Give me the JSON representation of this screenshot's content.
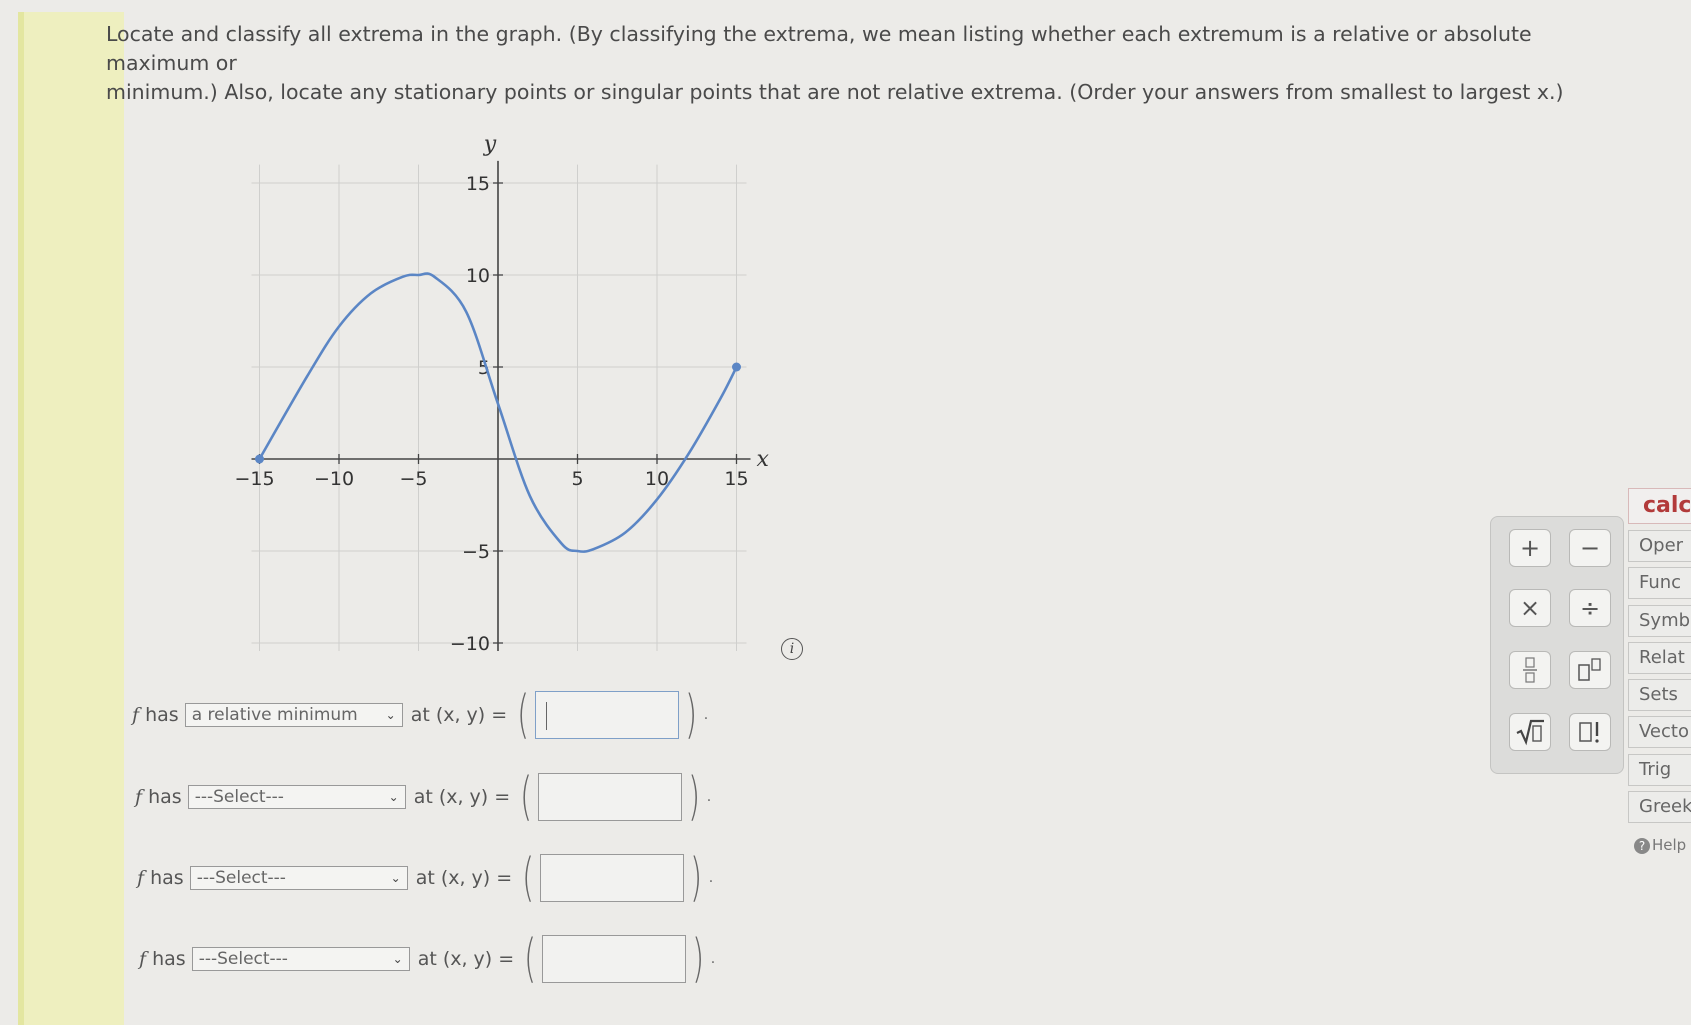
{
  "prompt": {
    "line1": "Locate and classify all extrema in the graph. (By classifying the extrema, we mean listing whether each extremum is a relative or absolute maximum or",
    "line2": "minimum.) Also, locate any stationary points or singular points that are not relative extrema. (Order your answers from smallest to largest x.)"
  },
  "graph": {
    "x_axis_label": "x",
    "y_axis_label": "y",
    "x_ticks": [
      "−15",
      "−10",
      "−5",
      "5",
      "10",
      "15"
    ],
    "y_ticks": [
      "15",
      "10",
      "5",
      "−5",
      "−10"
    ],
    "curve_color": "#5b86c5"
  },
  "chart_data": {
    "type": "line",
    "xlim": [
      -15,
      15
    ],
    "ylim": [
      -10,
      15
    ],
    "grid": true,
    "x": [
      -15,
      -12,
      -10,
      -8,
      -6,
      -5,
      -4,
      -2,
      0,
      2,
      4,
      5,
      6,
      8,
      10,
      12,
      14,
      15
    ],
    "y": [
      0,
      4.5,
      7.2,
      9,
      9.9,
      10,
      9.9,
      8,
      3,
      -2,
      -4.6,
      -5,
      -4.9,
      -4,
      -2.2,
      0.3,
      3.3,
      5
    ],
    "endpoints": [
      [
        -15,
        0
      ],
      [
        15,
        5
      ]
    ]
  },
  "rows": [
    {
      "fhas": "has",
      "select": "a relative minimum",
      "at": "at (x, y) =",
      "value": ""
    },
    {
      "fhas": "has",
      "select": "---Select---",
      "at": "at (x, y) =",
      "value": ""
    },
    {
      "fhas": "has",
      "select": "---Select---",
      "at": "at (x, y) =",
      "value": ""
    },
    {
      "fhas": "has",
      "select": "---Select---",
      "at": "at (x, y) =",
      "value": ""
    }
  ],
  "palette": {
    "buttons": [
      "+",
      "−",
      "×",
      "÷",
      "fraction-icon",
      "power-icon",
      "sqrt-icon",
      "factorial-icon"
    ]
  },
  "side_tabs": {
    "title": "calc",
    "items": [
      "Oper",
      "Func",
      "Symb",
      "Relat",
      "Sets",
      "Vecto",
      "Trig",
      "Greek"
    ],
    "help": "Help"
  }
}
